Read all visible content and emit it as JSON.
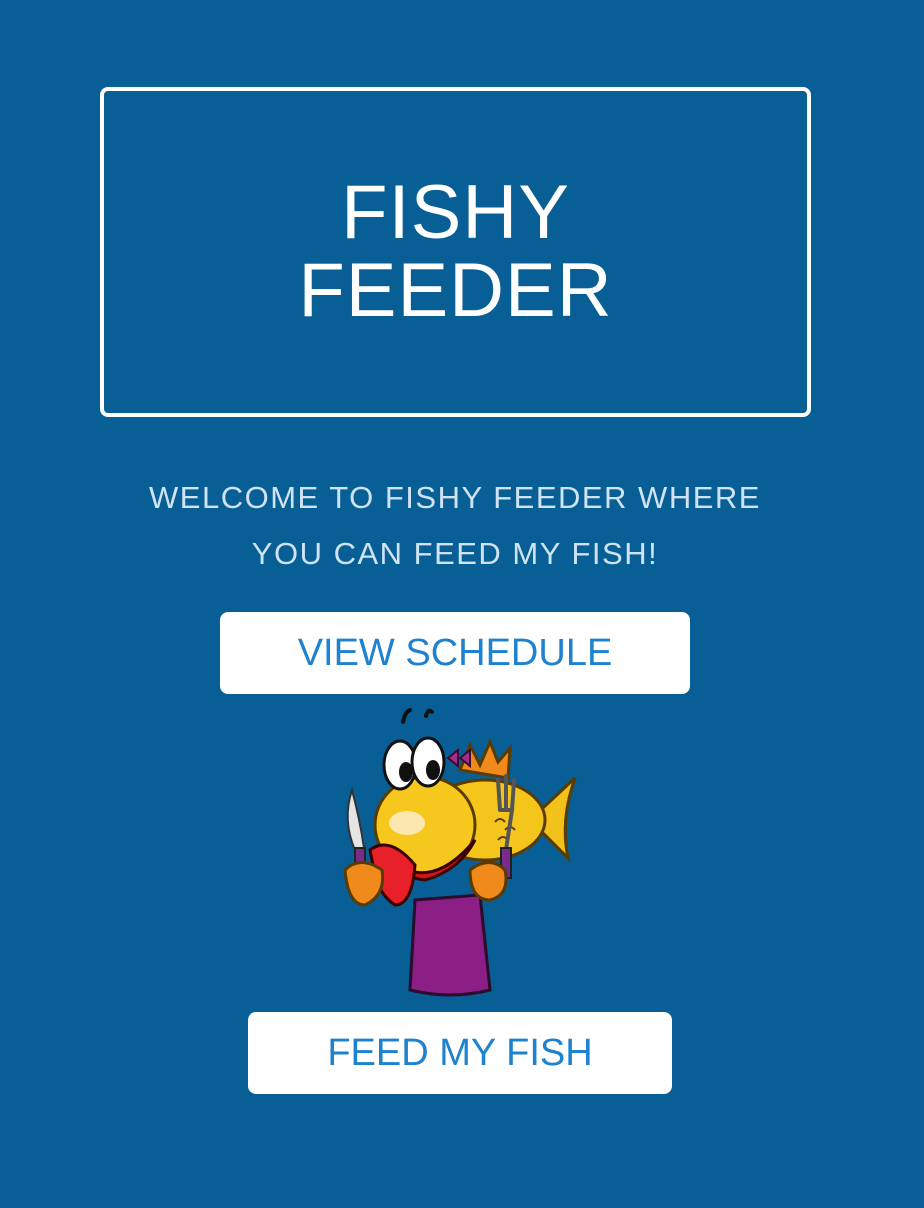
{
  "header": {
    "title_line1": "FISHY",
    "title_line2": "FEEDER"
  },
  "welcome": {
    "line1": "WELCOME TO FISHY FEEDER WHERE",
    "line2": "YOU CAN FEED MY FISH!"
  },
  "buttons": {
    "view_schedule": "VIEW SCHEDULE",
    "feed_my_fish": "FEED MY FISH"
  },
  "illustration": {
    "icon": "hungry-fish-with-cutlery-icon"
  },
  "colors": {
    "background": "#085f96",
    "button_text": "#1f82cf",
    "welcome_text": "#cfe3f3"
  }
}
